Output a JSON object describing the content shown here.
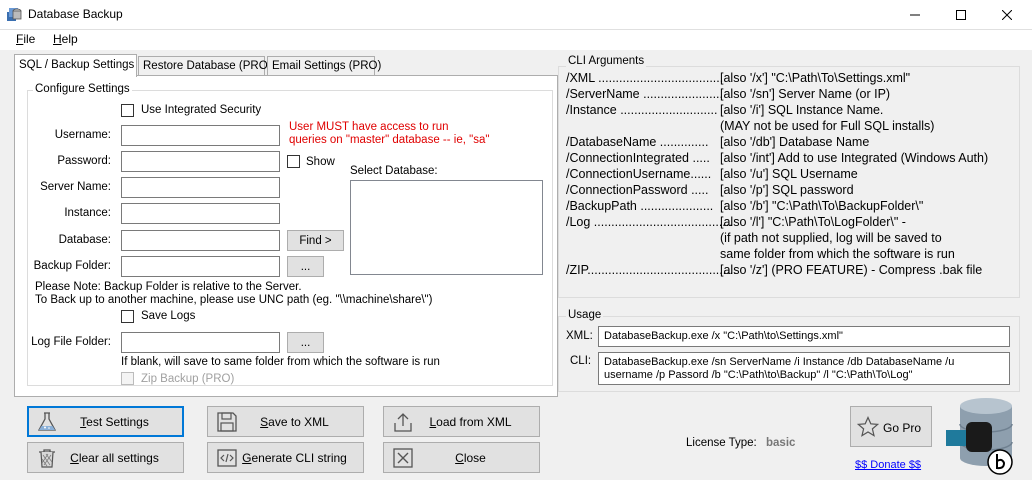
{
  "window": {
    "title": "Database Backup"
  },
  "menu": [
    {
      "key": "F",
      "rest": "ile"
    },
    {
      "key": "H",
      "rest": "elp"
    }
  ],
  "tabs": [
    {
      "label": "SQL / Backup Settings",
      "active": true
    },
    {
      "label": "Restore Database (PRO)",
      "active": false
    },
    {
      "label": "Email Settings (PRO)",
      "active": false
    }
  ],
  "configure": {
    "legend": "Configure Settings",
    "integrated_security": "Use Integrated Security",
    "username_label": "Username:",
    "password_label": "Password:",
    "show_label": "Show",
    "server_label": "Server Name:",
    "instance_label": "Instance:",
    "database_label": "Database:",
    "backup_folder_label": "Backup Folder:",
    "find_button": "Find >",
    "browse_button": "...",
    "warning_line1": "User MUST have access to run",
    "warning_line2": "queries on \"master\" database -- ie, \"sa\"",
    "select_db_label": "Select Database:",
    "note_line1": "Please Note: Backup Folder is relative to the Server.",
    "note_line2": "To Back up to another machine, please use UNC path (eg. \"\\\\machine\\share\\\")",
    "save_logs": "Save Logs",
    "log_folder_label": "Log File Folder:",
    "log_hint": "If blank, will save to same folder from which the software is run",
    "zip_backup": "Zip Backup (PRO)"
  },
  "cli": {
    "legend": "CLI Arguments",
    "rows": [
      {
        "arg": "/XML ....................................",
        "desc": "[also '/x'] \"C:\\Path\\To\\Settings.xml\""
      },
      {
        "arg": "/ServerName .......................",
        "desc": "[also '/sn'] Server Name (or IP)"
      },
      {
        "arg": "/Instance ............................",
        "desc": "[also '/i'] SQL Instance Name."
      },
      {
        "arg": "",
        "desc": "(MAY not be used for Full SQL installs)"
      },
      {
        "arg": "/DatabaseName ..............",
        "desc": "[also '/db'] Database Name"
      },
      {
        "arg": "/ConnectionIntegrated .....",
        "desc": "[also '/int'] Add to use Integrated (Windows Auth)"
      },
      {
        "arg": "/ConnectionUsername......",
        "desc": "[also '/u'] SQL Username"
      },
      {
        "arg": "/ConnectionPassword .....",
        "desc": "[also '/p'] SQL password"
      },
      {
        "arg": "/BackupPath .....................",
        "desc": "[also '/b'] \"C:\\Path\\To\\BackupFolder\\\""
      },
      {
        "arg": "/Log ........................................",
        "desc": "[also '/l'] \"C:\\Path\\To\\LogFolder\\\" -"
      },
      {
        "arg": "",
        "desc": "(if path not supplied, log will be saved to"
      },
      {
        "arg": "",
        "desc": "same folder from which the software is run"
      },
      {
        "arg": "/ZIP...........................................",
        "desc": "[also '/z'] (PRO FEATURE) - Compress .bak file"
      }
    ]
  },
  "usage": {
    "legend": "Usage",
    "xml_label": "XML:",
    "xml_value": "DatabaseBackup.exe /x \"C:\\Path\\to\\Settings.xml\"",
    "cli_label": "CLI:",
    "cli_value": "DatabaseBackup.exe /sn ServerName /i Instance /db DatabaseName /u username /p Passord /b \"C:\\Path\\to\\Backup\" /l \"C:\\Path\\To\\Log\""
  },
  "buttons": {
    "test": {
      "key": "T",
      "rest": "est Settings"
    },
    "save": {
      "key": "S",
      "rest": "ave to XML"
    },
    "load": {
      "key": "L",
      "rest": "oad from XML"
    },
    "clear": {
      "key": "C",
      "rest": "lear all settings"
    },
    "generate": {
      "key": "G",
      "rest": "enerate CLI string"
    },
    "close": {
      "key": "C",
      "rest": "lose"
    }
  },
  "license": {
    "label": "License Type:",
    "value": "basic"
  },
  "gopro": {
    "label": "Go Pro"
  },
  "donate": {
    "label": "$$ Donate $$"
  },
  "icons": {
    "app": "database-backup-icon",
    "test": "flask-icon",
    "save": "floppy-disk-icon",
    "load": "upload-icon",
    "clear": "trash-can-icon",
    "generate": "code-icon",
    "close": "close-box-icon",
    "gopro": "star-icon",
    "logo": "database-fist-logo-icon"
  }
}
